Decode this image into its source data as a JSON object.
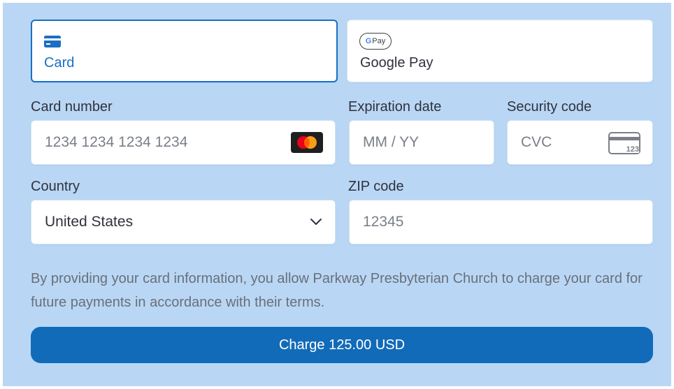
{
  "payment_methods": {
    "card_label": "Card",
    "gpay_badge_g": "G",
    "gpay_badge_text": "Pay",
    "gpay_label": "Google Pay",
    "selected": "Card"
  },
  "card_number": {
    "label": "Card number",
    "placeholder": "1234 1234 1234 1234",
    "brand_icon": "mastercard-icon"
  },
  "expiration": {
    "label": "Expiration date",
    "placeholder": "MM / YY"
  },
  "security_code": {
    "label": "Security code",
    "placeholder": "CVC",
    "icon_text": "123"
  },
  "country": {
    "label": "Country",
    "value": "United States"
  },
  "zip": {
    "label": "ZIP code",
    "placeholder": "12345"
  },
  "notice": "By providing your card information, you allow Parkway Presbyterian Church to charge your card for future payments in accordance with their terms.",
  "charge_button": "Charge 125.00 USD",
  "colors": {
    "background": "#b9d7f5",
    "accent": "#1a6fc4",
    "button": "#126bb9"
  }
}
